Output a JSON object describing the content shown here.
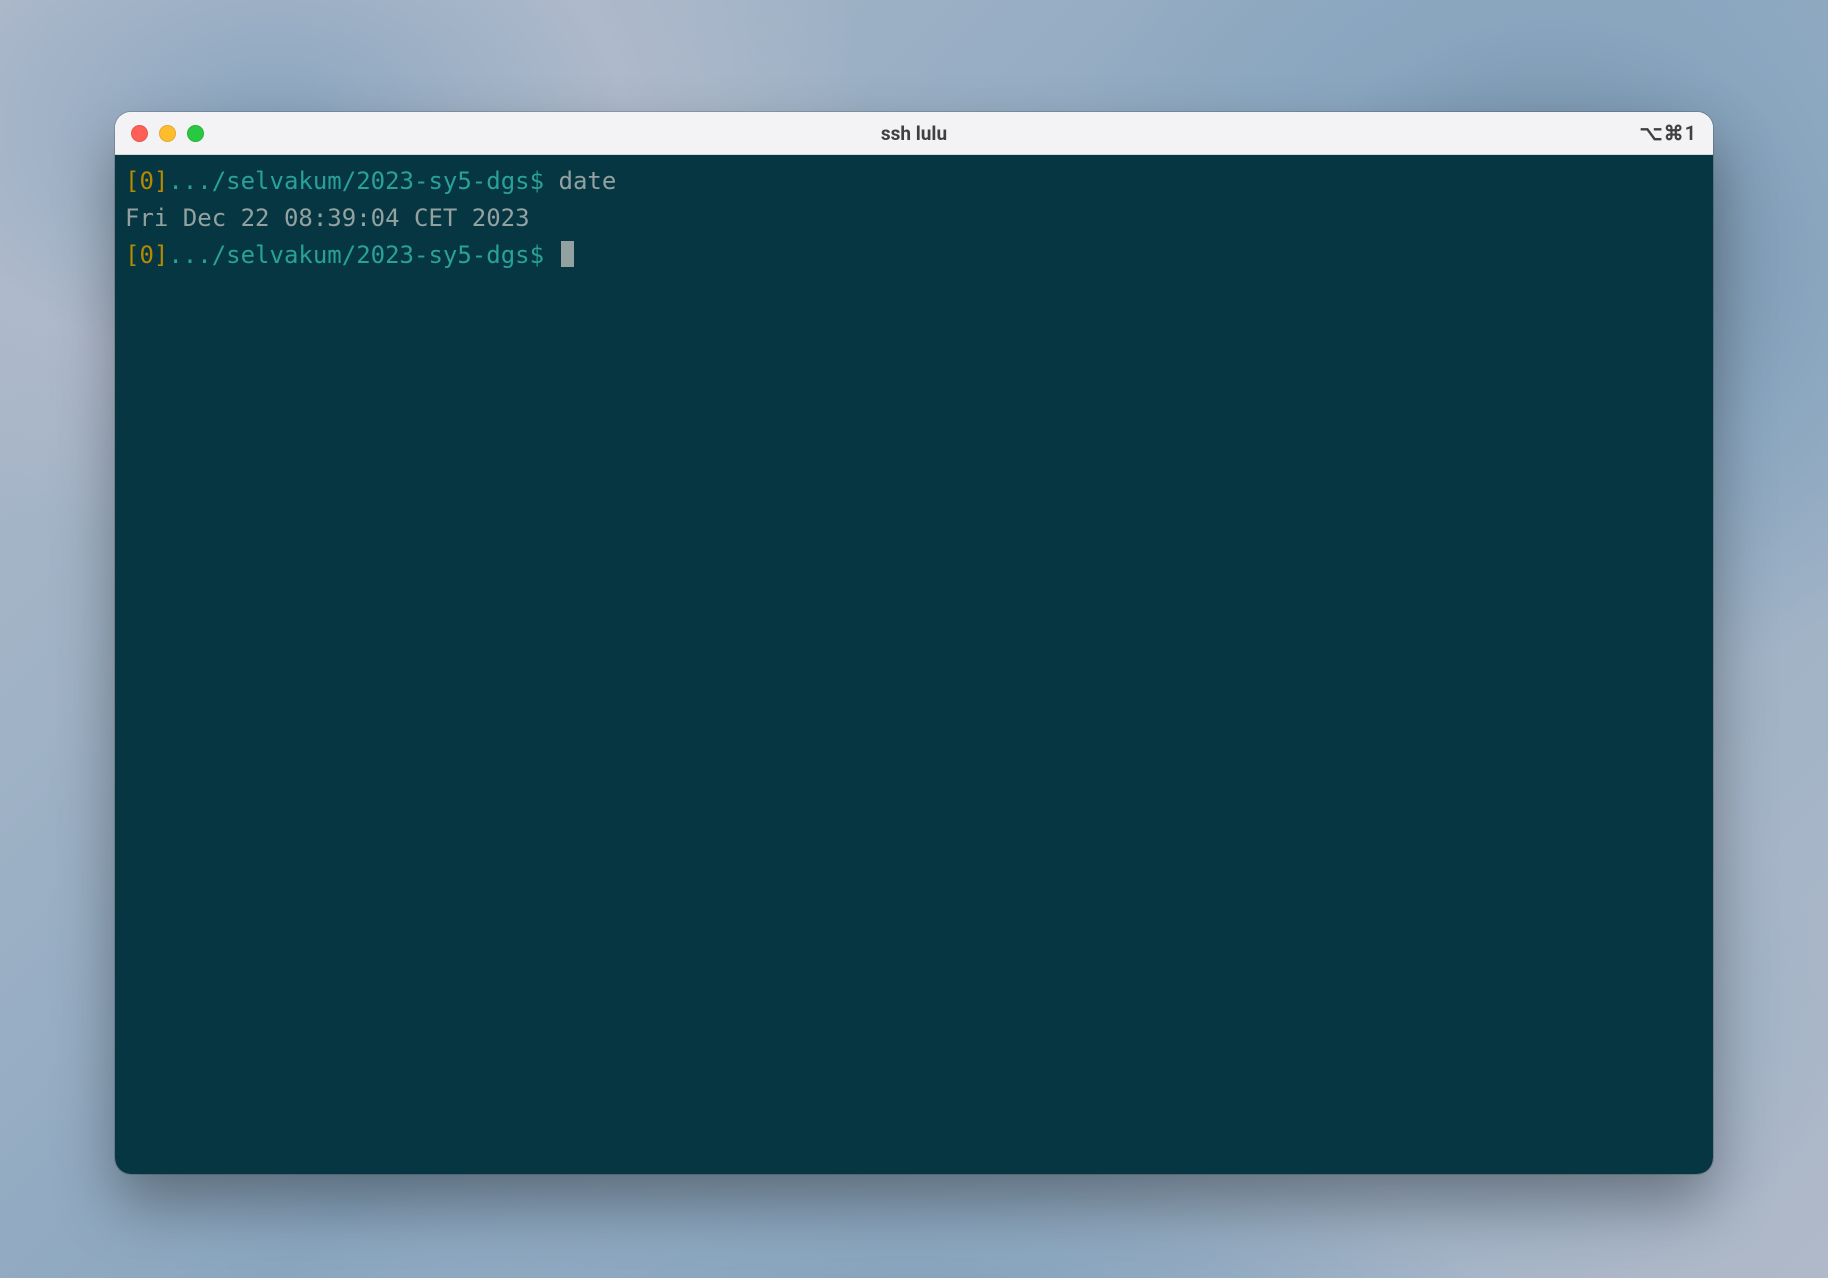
{
  "window": {
    "title": "ssh lulu",
    "right_indicator": "⌥⌘1"
  },
  "terminal": {
    "lines": [
      {
        "status": "[0]",
        "path": ".../selvakum/2023-sy5-dgs",
        "dollar": "$",
        "command": "date"
      },
      {
        "output": "Fri Dec 22 08:39:04 CET 2023"
      },
      {
        "status": "[0]",
        "path": ".../selvakum/2023-sy5-dgs",
        "dollar": "$",
        "command": ""
      }
    ]
  }
}
